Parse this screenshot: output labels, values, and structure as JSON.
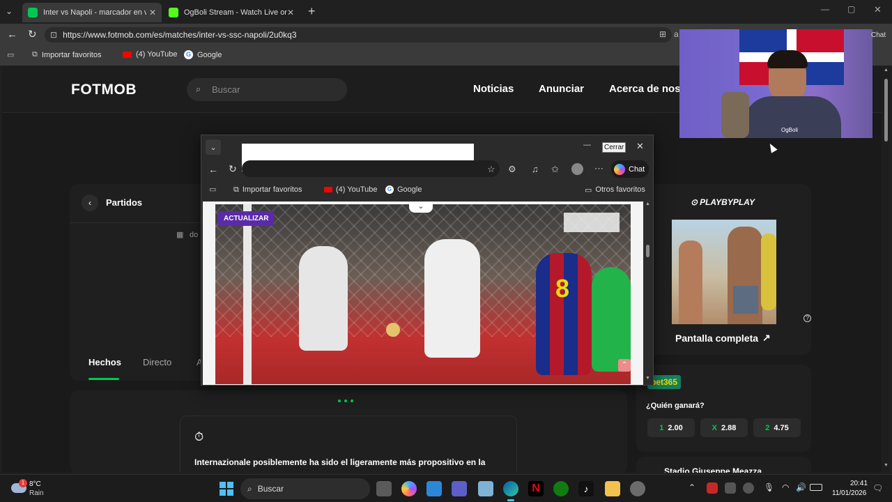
{
  "browser": {
    "tabs": [
      {
        "label": "Inter vs Napoli - marcador en vivo",
        "active": true,
        "favicon_color": "#00c853"
      },
      {
        "label": "OgBoli Stream - Watch Live on Kick",
        "active": false,
        "favicon_color": "#53fc18"
      }
    ],
    "url": "https://www.fotmob.com/es/matches/inter-vs-ssc-napoli/2u0kq3",
    "bookmarks": [
      "Importar favoritos",
      "(4) YouTube",
      "Google"
    ],
    "chat_label": "Chat"
  },
  "fotmob": {
    "logo": "FOTMOB",
    "search_placeholder": "Buscar",
    "nav": [
      "Noticias",
      "Anunciar",
      "Acerca de nos"
    ],
    "back_label": "Partidos",
    "date_partial": "do",
    "tabs": [
      "Hechos",
      "Directo",
      "A"
    ],
    "insight_text": "Internazionale posiblemente ha sido el ligeramente más propositivo en la",
    "playbyplay": {
      "brand": "PLAYBYPLAY",
      "fullscreen_label": "Pantalla completa"
    },
    "betting": {
      "brand": "bet365",
      "question": "¿Quién ganará?",
      "odds": [
        {
          "label": "1",
          "value": "2.00"
        },
        {
          "label": "X",
          "value": "2.88"
        },
        {
          "label": "2",
          "value": "4.75"
        }
      ]
    },
    "stadium": "Stadio Giuseppe Meazza"
  },
  "popup": {
    "close_tooltip": "Cerrar",
    "bookmarks": [
      "Importar favoritos",
      "(4) YouTube",
      "Google"
    ],
    "other_favorites": "Otros favoritos",
    "chat_label": "Chat",
    "video_badge": "ACTUALIZAR",
    "jersey_number": "8"
  },
  "webcam": {
    "overlay_text": "OgBoli"
  },
  "taskbar": {
    "weather_temp": "8°C",
    "weather_desc": "Rain",
    "weather_badge": "1",
    "search_placeholder": "Buscar",
    "time": "20:41",
    "date": "11/01/2026"
  },
  "colors": {
    "accent_green": "#00c853",
    "betting_green": "#14805e",
    "popup_badge": "#5b2aa8"
  }
}
